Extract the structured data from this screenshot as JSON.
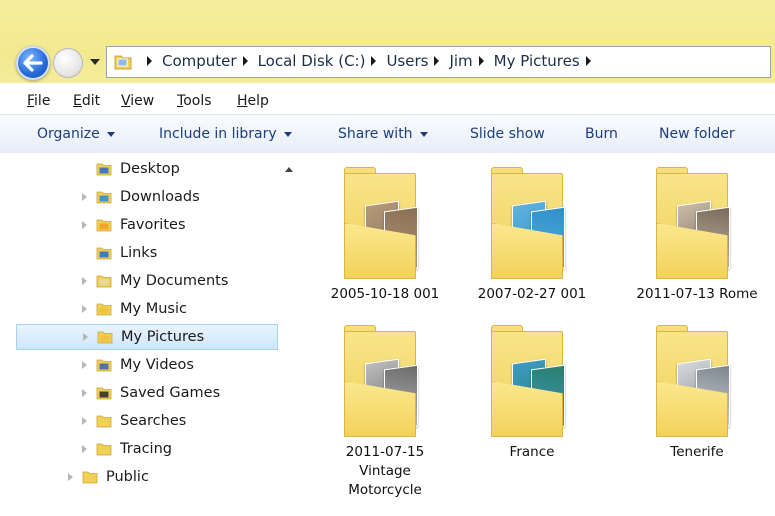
{
  "nav": {
    "breadcrumbs": [
      "Computer",
      "Local Disk (C:)",
      "Users",
      "Jim",
      "My Pictures"
    ]
  },
  "menu": [
    {
      "key": "F",
      "rest": "ile"
    },
    {
      "key": "E",
      "rest": "dit"
    },
    {
      "key": "V",
      "rest": "iew"
    },
    {
      "key": "T",
      "rest": "ools"
    },
    {
      "key": "H",
      "rest": "elp"
    }
  ],
  "toolbar": {
    "organize": "Organize",
    "include_in_library": "Include in library",
    "share_with": "Share with",
    "slide_show": "Slide show",
    "burn": "Burn",
    "new_folder": "New folder"
  },
  "navpane": {
    "items": [
      {
        "label": "Desktop",
        "icon": "desktop-icon"
      },
      {
        "label": "Downloads",
        "icon": "downloads-icon"
      },
      {
        "label": "Favorites",
        "icon": "favorites-icon"
      },
      {
        "label": "Links",
        "icon": "links-icon"
      },
      {
        "label": "My Documents",
        "icon": "documents-icon"
      },
      {
        "label": "My Music",
        "icon": "music-icon"
      },
      {
        "label": "My Pictures",
        "icon": "pictures-icon",
        "selected": true
      },
      {
        "label": "My Videos",
        "icon": "videos-icon"
      },
      {
        "label": "Saved Games",
        "icon": "saved-games-icon"
      },
      {
        "label": "Searches",
        "icon": "searches-icon"
      },
      {
        "label": "Tracing",
        "icon": "folder-icon"
      },
      {
        "label": "Public",
        "icon": "folder-icon"
      }
    ]
  },
  "folders": [
    {
      "label": "2005-10-18 001",
      "thumbs": [
        "#8a6f55",
        "#b49a78"
      ]
    },
    {
      "label": "2007-02-27 001",
      "thumbs": [
        "#2e8fc9",
        "#5fb2de"
      ]
    },
    {
      "label": "2011-07-13 Rome",
      "thumbs": [
        "#7a6a5a",
        "#c8bca8"
      ]
    },
    {
      "label": "2011-07-15 Vintage Motorcycle",
      "thumbs": [
        "#6b6b6b",
        "#bdbdbd"
      ]
    },
    {
      "label": "France",
      "thumbs": [
        "#2a7e6e",
        "#3f9ac4"
      ]
    },
    {
      "label": "Tenerife",
      "thumbs": [
        "#7d8790",
        "#d7d9db"
      ]
    }
  ],
  "colors": {
    "title_band": "#f4ec9a",
    "toolbar_text": "#1e3d7a",
    "selection": "#cde6fb",
    "folder": "#f4d964"
  }
}
